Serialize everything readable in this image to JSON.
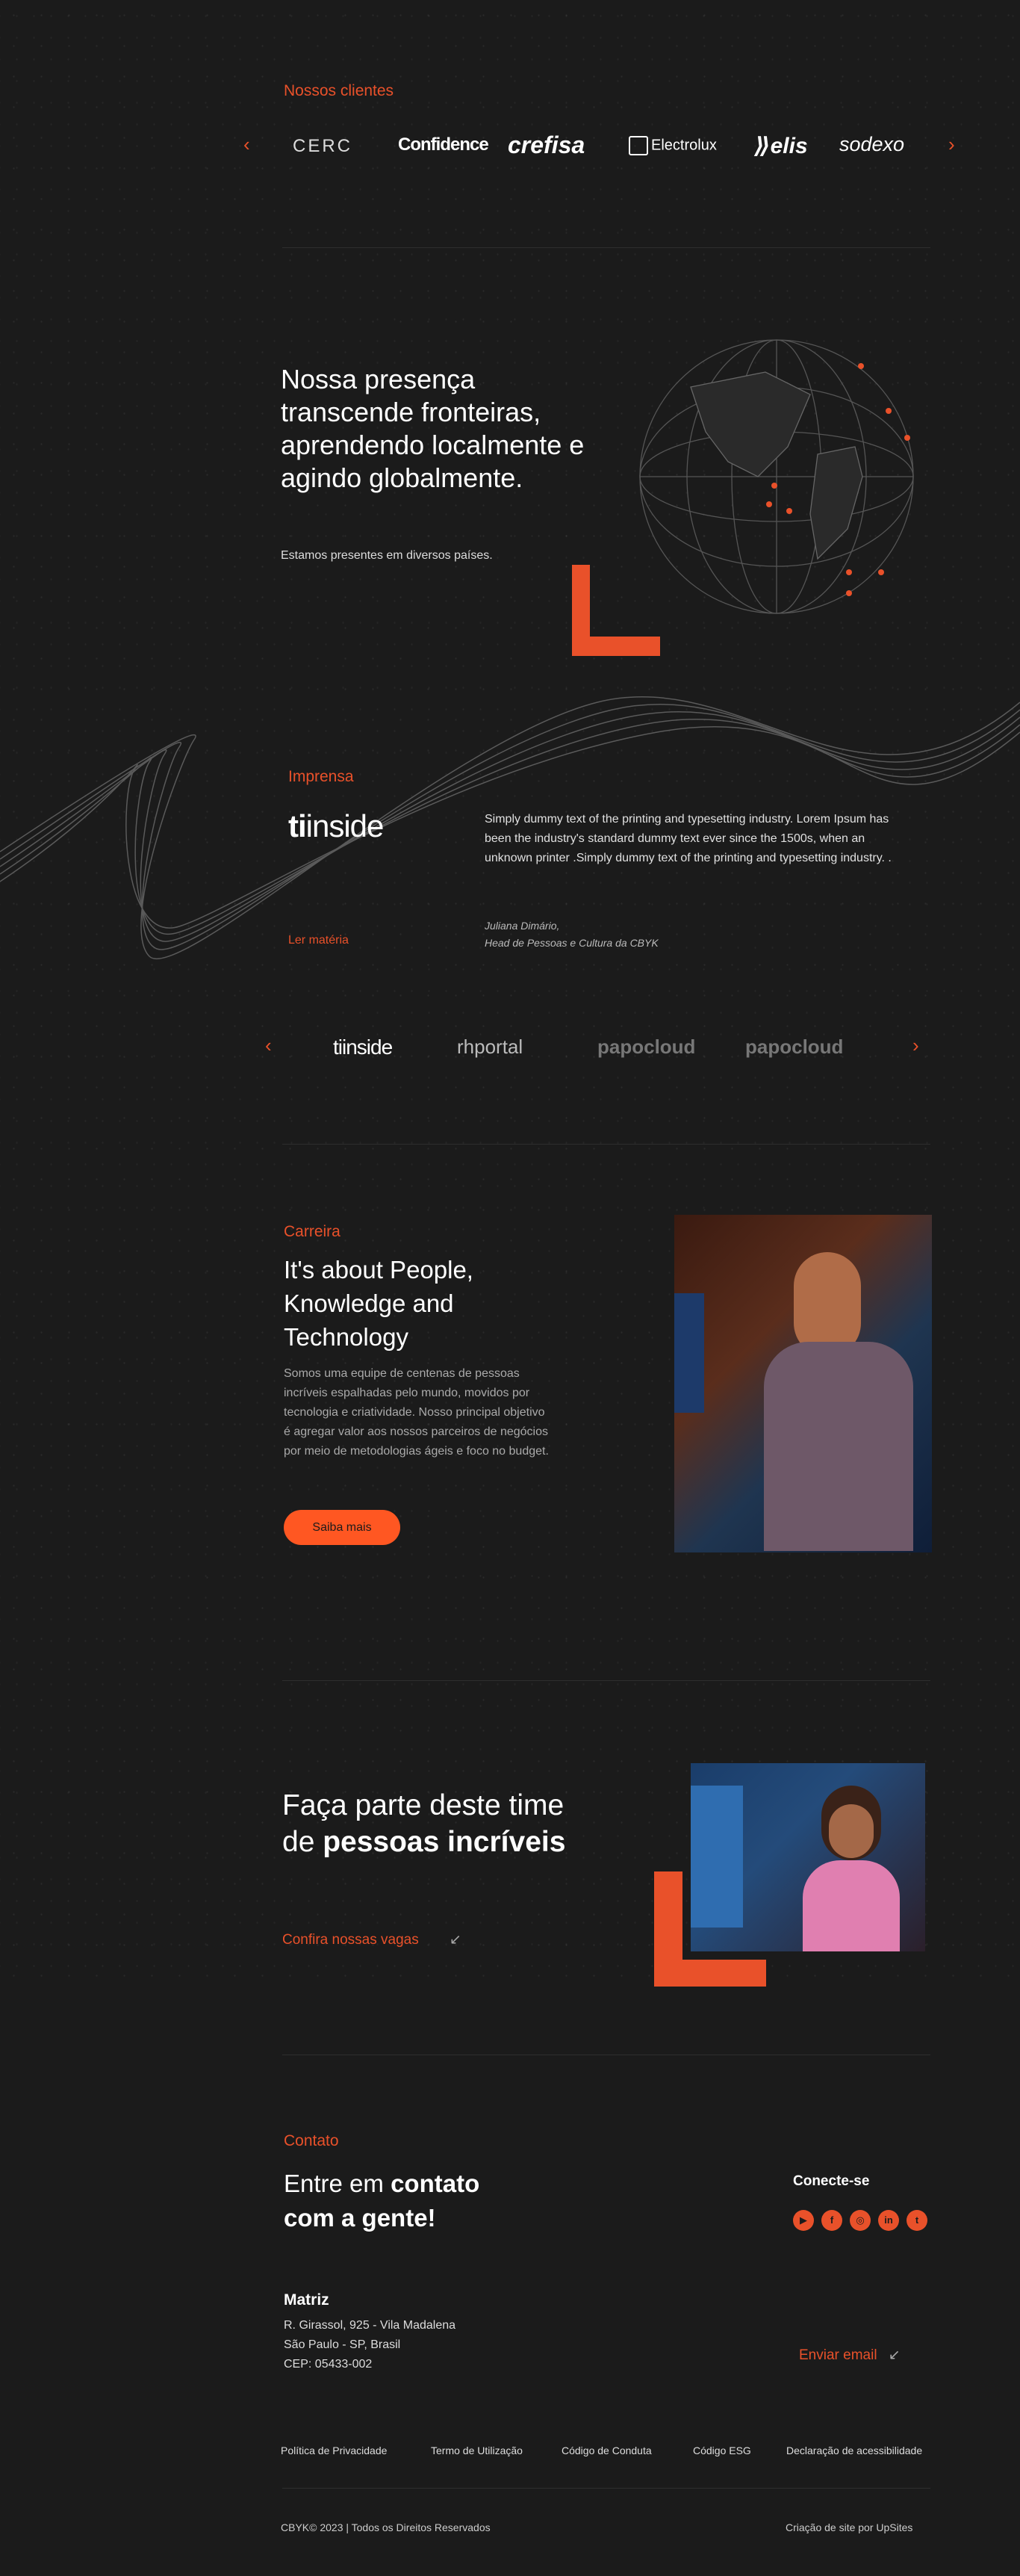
{
  "clients": {
    "title": "Nossos clientes",
    "logos": [
      "CERC",
      "Confidence",
      "crefisa",
      "Electrolux",
      "elis",
      "sodexo"
    ],
    "prev_icon": "chevron-left-icon",
    "next_icon": "chevron-right-icon"
  },
  "presence": {
    "heading": "Nossa presença transcende fronteiras, aprendendo localmente e agindo globalmente.",
    "subtitle": "Estamos presentes em diversos países."
  },
  "press": {
    "title": "Imprensa",
    "featured_logo": "tiinside",
    "quote": "Simply dummy text of the printing and typesetting industry. Lorem Ipsum has been the industry's standard dummy text ever since the 1500s, when an unknown printer .Simply dummy text of the printing and typesetting industry. .",
    "author_name": "Juliana Dimário,",
    "author_role": "Head de Pessoas e Cultura da CBYK",
    "read_link": "Ler matéria",
    "carousel_logos": [
      "tiinside",
      "rhportal",
      "papocloud",
      "papocloud"
    ]
  },
  "career": {
    "title": "Carreira",
    "heading": "It's about People, Knowledge and Technology",
    "body": "Somos uma equipe de centenas de pessoas incríveis espalhadas pelo mundo, movidos por tecnologia e criatividade. Nosso principal objetivo é agregar valor aos nossos parceiros de negócios por meio de metodologias ágeis e foco no budget.",
    "button": "Saiba mais"
  },
  "join": {
    "heading_part1": "Faça parte deste time de ",
    "heading_bold": "pessoas incríveis",
    "link": "Confira nossas vagas"
  },
  "contact": {
    "title": "Contato",
    "heading_part1": "Entre em ",
    "heading_bold1": "contato",
    "heading_bold2": "com a gente!",
    "connect": "Conecte-se",
    "social": [
      "youtube-icon",
      "facebook-icon",
      "instagram-icon",
      "linkedin-icon",
      "twitter-icon"
    ],
    "hq_title": "Matriz",
    "address1": "R. Girassol, 925 - Vila Madalena",
    "address2": "São Paulo - SP, Brasil",
    "address3": "CEP: 05433-002",
    "email_link": "Enviar email"
  },
  "footer": {
    "links": [
      "Política de  Privacidade",
      "Termo de Utilização",
      "Código de Conduta",
      "Código ESG",
      "Declaração de acessibilidade"
    ],
    "copyright": "CBYK© 2023 | Todos os Direitos Reservados",
    "credit": "Criação de site por UpSites"
  },
  "colors": {
    "accent": "#e9512a",
    "background": "#1b1b1b"
  }
}
